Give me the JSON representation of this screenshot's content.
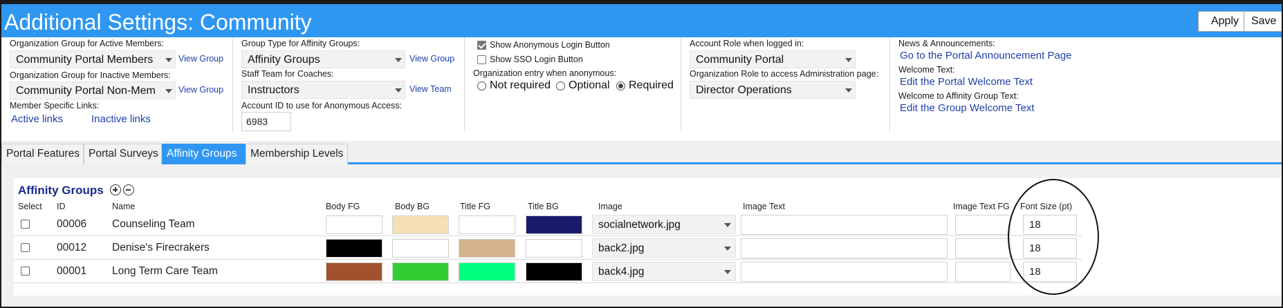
{
  "header": {
    "title": "Additional Settings: Community",
    "apply_label": "Apply",
    "save_label": "Save",
    "bg_color": "#2f97f2"
  },
  "settings": {
    "col1": {
      "active_members_label": "Organization Group for Active Members:",
      "active_members_value": "Community Portal Members",
      "view_group_1": "View Group",
      "inactive_members_label": "Organization Group for Inactive Members:",
      "inactive_members_value": "Community Portal Non-Mem",
      "view_group_2": "View Group",
      "member_links_label": "Member Specific Links:",
      "active_links": "Active links",
      "inactive_links": "Inactive links"
    },
    "col2": {
      "group_type_label": "Group Type for Affinity Groups:",
      "group_type_value": "Affinity Groups",
      "view_group": "View Group",
      "staff_team_label": "Staff Team for Coaches:",
      "staff_team_value": "Instructors",
      "view_team": "View Team",
      "account_id_label": "Account ID to use for Anonymous Access:",
      "account_id_value": "6983"
    },
    "col3": {
      "show_anon_label": "Show Anonymous Login Button",
      "show_anon_checked": true,
      "show_sso_label": "Show SSO Login Button",
      "show_sso_checked": false,
      "org_entry_label": "Organization entry when anonymous:",
      "opt_not_required": "Not required",
      "opt_optional": "Optional",
      "opt_required": "Required",
      "selected": "Required"
    },
    "col4": {
      "account_role_label": "Account Role when logged in:",
      "account_role_value": "Community Portal",
      "admin_role_label": "Organization Role to access Administration page:",
      "admin_role_value": "Director Operations"
    },
    "col5": {
      "news_label": "News & Announcements:",
      "news_link": "Go to the Portal Announcement Page",
      "welcome_label": "Welcome Text:",
      "welcome_link": "Edit the Portal Welcome Text",
      "affinity_welcome_label": "Welcome to Affinity Group Text:",
      "affinity_welcome_link": "Edit the Group Welcome Text"
    }
  },
  "tabs": [
    {
      "label": "Portal Features",
      "active": false
    },
    {
      "label": "Portal Surveys",
      "active": false
    },
    {
      "label": "Affinity Groups",
      "active": true
    },
    {
      "label": "Membership Levels",
      "active": false
    }
  ],
  "affinity": {
    "title": "Affinity Groups",
    "columns": [
      "Select",
      "ID",
      "Name",
      "Body FG",
      "Body BG",
      "Title FG",
      "Title BG",
      "Image",
      "Image Text",
      "Image Text FG",
      "Font Size (pt)"
    ],
    "rows": [
      {
        "id": "00006",
        "name": "Counseling Team",
        "body_fg": "#ffffff",
        "body_bg": "#f6dfb6",
        "title_fg": "#ffffff",
        "title_bg": "#1a1a6b",
        "image": "socialnetwork.jpg",
        "image_text": "",
        "image_text_fg": "#ffffff",
        "font_size": "18"
      },
      {
        "id": "00012",
        "name": "Denise's Firecrakers",
        "body_fg": "#000000",
        "body_bg": "#ffffff",
        "title_fg": "#d3b48a",
        "title_bg": "#ffffff",
        "image": "back2.jpg",
        "image_text": "",
        "image_text_fg": "#ffffff",
        "font_size": "18"
      },
      {
        "id": "00001",
        "name": "Long Term Care Team",
        "body_fg": "#a0522d",
        "body_bg": "#32cd32",
        "title_fg": "#00ff7f",
        "title_bg": "#000000",
        "image": "back4.jpg",
        "image_text": "",
        "image_text_fg": "#ffffff",
        "font_size": "18"
      }
    ]
  }
}
